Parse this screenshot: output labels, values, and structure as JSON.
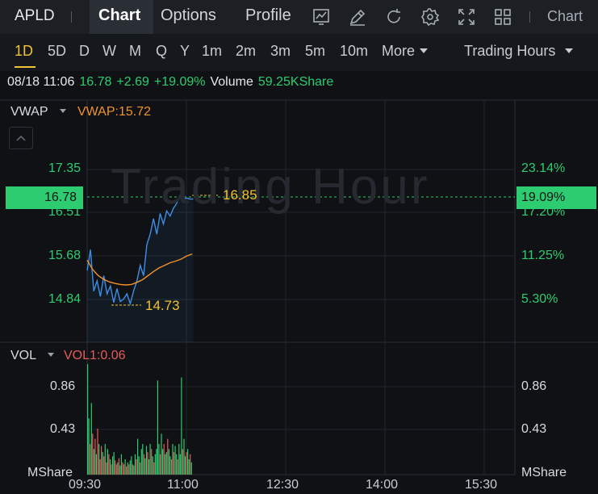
{
  "header": {
    "symbol": "APLD",
    "tabs": [
      {
        "label": "Chart",
        "active": true
      },
      {
        "label": "Options",
        "active": false
      },
      {
        "label": "Profile",
        "active": false
      }
    ],
    "tools": [
      "chart-type-icon",
      "draw-icon",
      "refresh-icon",
      "settings-icon",
      "fullscreen-icon",
      "layout-grid-icon"
    ],
    "chart_menu_label": "Chart"
  },
  "periods": {
    "items": [
      "1D",
      "5D",
      "D",
      "W",
      "M",
      "Q",
      "Y",
      "1m",
      "2m",
      "3m",
      "5m",
      "10m"
    ],
    "active": "1D",
    "more_label": "More",
    "session_label": "Trading Hours"
  },
  "quote": {
    "datetime": "08/18 11:06",
    "price": "16.78",
    "change": "+2.69",
    "change_pct": "+19.09%",
    "volume_label": "Volume",
    "volume_value": "59.25KShare"
  },
  "price_panel": {
    "indicator": "VWAP",
    "indicator_value": "VWAP:15.72",
    "watermark": "Trading Hour",
    "left_ticks": [
      "17.35",
      "16.51",
      "15.68",
      "14.84"
    ],
    "right_ticks": [
      "23.14%",
      "17.20%",
      "11.25%",
      "5.30%"
    ],
    "current_price_tag": "16.78",
    "current_pct_tag": "19.09%",
    "high_label": "16.85",
    "low_label": "14.73"
  },
  "volume_panel": {
    "indicator": "VOL",
    "indicator_value": "VOL1:0.06",
    "left_ticks": [
      "0.86",
      "0.43"
    ],
    "right_ticks": [
      "0.86",
      "0.43"
    ],
    "unit_left": "MShare",
    "unit_right": "MShare"
  },
  "x_axis": [
    "09:30",
    "11:00",
    "12:30",
    "14:00",
    "15:30"
  ],
  "colors": {
    "up": "#2ecc71",
    "down": "#e85a5a",
    "price_line": "#3d8fe6",
    "vwap_line": "#f0932b",
    "accent": "#f1c232"
  },
  "chart_data": {
    "type": "line",
    "ylim": [
      14.3,
      17.9
    ],
    "series": [
      {
        "name": "VWAP",
        "x": [
          0,
          5,
          10,
          15,
          20,
          25,
          30,
          35,
          40,
          45,
          50,
          55,
          60,
          65,
          70,
          75,
          80,
          85,
          90,
          95
        ],
        "values": [
          15.6,
          15.42,
          15.3,
          15.23,
          15.18,
          15.15,
          15.13,
          15.12,
          15.13,
          15.17,
          15.22,
          15.3,
          15.38,
          15.45,
          15.5,
          15.55,
          15.58,
          15.62,
          15.68,
          15.72
        ]
      },
      {
        "x": [
          0,
          3,
          6,
          9,
          12,
          15,
          18,
          21,
          24,
          27,
          30,
          33,
          36,
          39,
          42,
          45,
          48,
          51,
          54,
          57,
          60,
          63,
          66,
          69,
          72,
          75,
          78,
          81,
          84,
          87,
          90,
          93,
          96
        ],
        "values": [
          15.4,
          15.8,
          15.0,
          15.2,
          14.9,
          15.3,
          14.95,
          15.1,
          14.78,
          15.05,
          14.8,
          14.85,
          14.95,
          14.76,
          15.0,
          15.2,
          15.5,
          15.3,
          15.9,
          16.1,
          16.4,
          16.1,
          16.5,
          16.3,
          16.55,
          16.45,
          16.6,
          16.7,
          16.85,
          16.78,
          16.8,
          16.78,
          16.78
        ]
      }
    ],
    "volume": {
      "unit": "MShare",
      "ylim": [
        0,
        1.1
      ],
      "values": [
        1.08,
        0.55,
        0.3,
        0.7,
        0.4,
        0.25,
        0.35,
        0.2,
        0.45,
        0.3,
        0.15,
        0.28,
        0.22,
        0.18,
        0.3,
        0.12,
        0.25,
        0.2,
        0.15,
        0.1,
        0.18,
        0.22,
        0.14,
        0.1,
        0.12,
        0.16,
        0.09,
        0.2,
        0.12,
        0.1,
        0.15,
        0.08,
        0.12,
        0.1,
        0.14,
        0.18,
        0.1,
        0.09,
        0.2,
        0.15,
        0.35,
        0.18,
        0.12,
        0.25,
        0.3,
        0.2,
        0.16,
        0.28,
        0.22,
        0.15,
        0.3,
        0.25,
        0.18,
        0.12,
        0.2,
        0.25,
        0.92,
        0.3,
        0.2,
        0.4,
        0.25,
        0.3,
        0.2,
        0.22,
        0.35,
        0.25,
        0.18,
        0.15,
        0.3,
        0.22,
        0.28,
        0.2,
        0.15,
        0.3,
        0.2,
        0.95,
        0.25,
        0.35,
        0.18,
        0.22,
        0.25,
        0.15,
        0.2,
        0.12
      ],
      "up": [
        1,
        1,
        0,
        1,
        0,
        1,
        0,
        1,
        0,
        1,
        0,
        0,
        1,
        0,
        1,
        0,
        1,
        0,
        1,
        0,
        1,
        1,
        0,
        0,
        1,
        0,
        1,
        1,
        0,
        0,
        1,
        0,
        1,
        0,
        1,
        1,
        0,
        1,
        1,
        0,
        1,
        1,
        0,
        1,
        1,
        0,
        1,
        1,
        0,
        1,
        1,
        0,
        1,
        0,
        1,
        1,
        1,
        1,
        0,
        1,
        1,
        0,
        1,
        1,
        0,
        1,
        1,
        0,
        1,
        0,
        1,
        1,
        0,
        1,
        1,
        1,
        0,
        1,
        1,
        0,
        1,
        1,
        0,
        1
      ]
    }
  }
}
